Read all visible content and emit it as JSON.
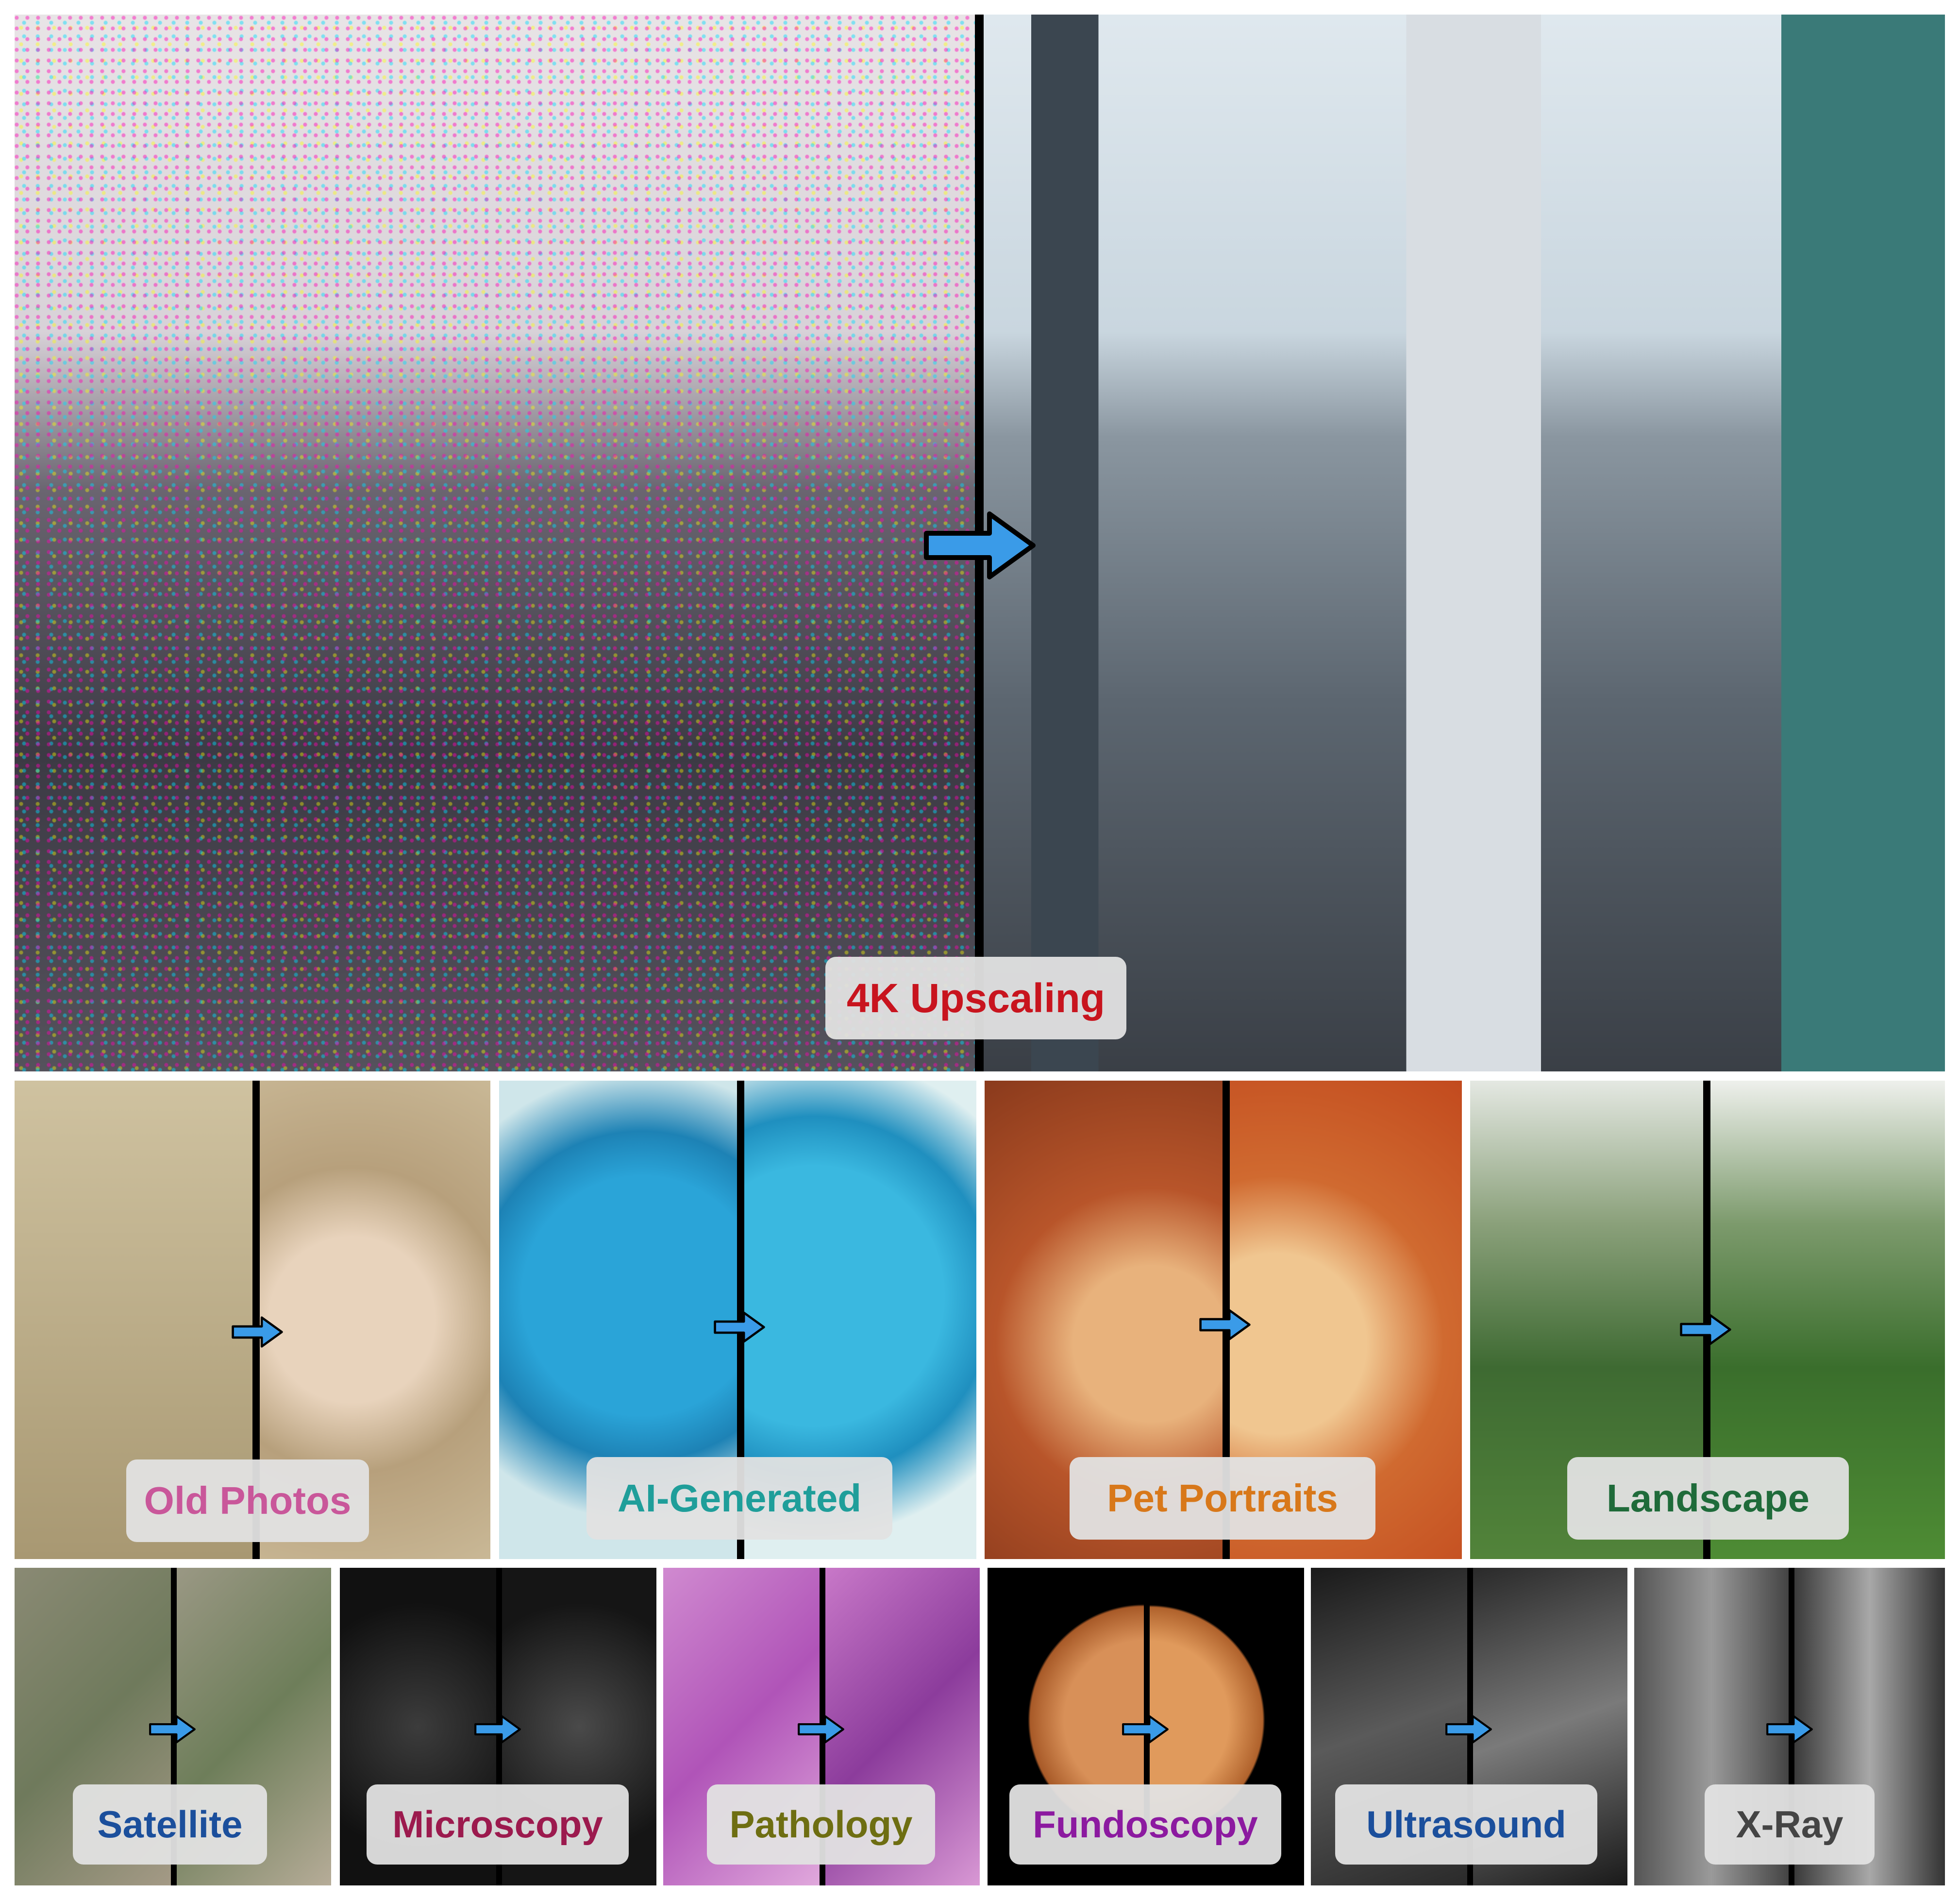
{
  "hero": {
    "label": "4K Upscaling",
    "label_color": "#c8141e"
  },
  "examples": [
    {
      "label": "Old Photos",
      "color": "#c9579a"
    },
    {
      "label": "AI-Generated",
      "color": "#1f9e9a"
    },
    {
      "label": "Pet Portraits",
      "color": "#d8781a"
    },
    {
      "label": "Landscape",
      "color": "#1f6b3a"
    }
  ],
  "medical": [
    {
      "label": "Satellite",
      "color": "#1b4f9c"
    },
    {
      "label": "Microscopy",
      "color": "#9c1a4e"
    },
    {
      "label": "Pathology",
      "color": "#6e6e12"
    },
    {
      "label": "Fundoscopy",
      "color": "#8c1aa0"
    },
    {
      "label": "Ultrasound",
      "color": "#1b4f9c"
    },
    {
      "label": "X-Ray",
      "color": "#444444"
    }
  ],
  "arrow_color": "#3a9be8",
  "icons": {
    "arrow": "right-arrow-icon"
  }
}
